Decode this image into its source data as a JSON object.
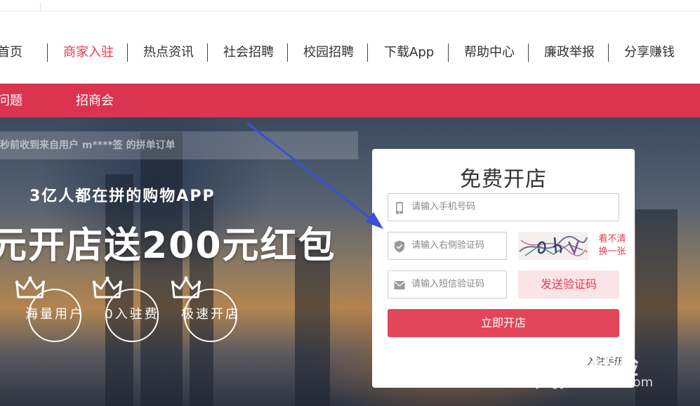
{
  "nav": {
    "items": [
      {
        "label": "首页",
        "active": false
      },
      {
        "label": "商家入驻",
        "active": true
      },
      {
        "label": "热点资讯",
        "active": false
      },
      {
        "label": "社会招聘",
        "active": false
      },
      {
        "label": "校园招聘",
        "active": false
      },
      {
        "label": "下载App",
        "active": false
      },
      {
        "label": "帮助中心",
        "active": false
      },
      {
        "label": "廉政举报",
        "active": false
      },
      {
        "label": "分享赚钱",
        "active": false
      }
    ]
  },
  "subnav": {
    "items": [
      {
        "label": "问题"
      },
      {
        "label": "招商会"
      }
    ]
  },
  "hero": {
    "ticker": "秒前收到来自用户 m****签 的拼单订单",
    "subtitle": "3亿人都在拼的购物APP",
    "title": "元开店送200元红包",
    "badges": [
      {
        "label": "海量用户",
        "icon": "crown-icon"
      },
      {
        "label": "0入驻费",
        "icon": "crown-icon"
      },
      {
        "label": "极速开店",
        "icon": "crown-icon"
      }
    ]
  },
  "form": {
    "title": "免费开店",
    "phone_placeholder": "请输入手机号码",
    "captcha_placeholder": "请输入右侧验证码",
    "sms_placeholder": "请输入短信验证码",
    "refresh_line1": "看不清",
    "refresh_line2": "换一张",
    "sms_button": "发送验证码",
    "submit": "立即开店",
    "login_link": "入驻手册"
  },
  "watermark": {
    "brand": "Bai 经验",
    "url": "jingyan.baidu.com"
  },
  "colors": {
    "accent": "#db3450",
    "button": "#e34559",
    "sms_bg": "#fbe4e7",
    "arrow": "#3b50d6"
  }
}
